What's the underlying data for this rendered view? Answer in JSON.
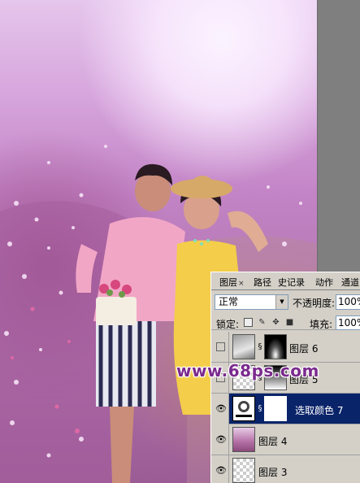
{
  "watermark": "www.68ps.com",
  "panel": {
    "tabs": [
      {
        "label": "图层",
        "close": "×",
        "active": true
      },
      {
        "label": "路径",
        "active": false
      },
      {
        "label": "史记录",
        "active": false
      },
      {
        "label": "动作",
        "active": false
      },
      {
        "label": "通道",
        "active": false
      }
    ],
    "blend_mode": "正常",
    "opacity_label": "不透明度:",
    "opacity_value": "100%",
    "lock_label": "锁定:",
    "fill_label": "填充:",
    "fill_value": "100%",
    "layers": [
      {
        "name": "图层 6",
        "visible": false,
        "selected": false,
        "has_mask": true,
        "thumb_icon": "layer-thumb",
        "mask_icon": "mask-black"
      },
      {
        "name": "图层 5",
        "visible": false,
        "selected": false,
        "has_mask": true,
        "thumb_icon": "layer-thumb",
        "mask_icon": "mask-gradient"
      },
      {
        "name": "选取颜色 7",
        "visible": true,
        "selected": true,
        "has_mask": true,
        "thumb_icon": "adjustment-icon",
        "mask_icon": "mask-white"
      },
      {
        "name": "图层 4",
        "visible": true,
        "selected": false,
        "has_mask": false,
        "thumb_icon": "photo-thumb"
      },
      {
        "name": "图层 3",
        "visible": true,
        "selected": false,
        "has_mask": false,
        "thumb_icon": "transparent-thumb"
      }
    ]
  },
  "colors": {
    "selection": "#0a246a",
    "panel_bg": "#d4d0c8",
    "watermark": "#7b2a8e"
  }
}
